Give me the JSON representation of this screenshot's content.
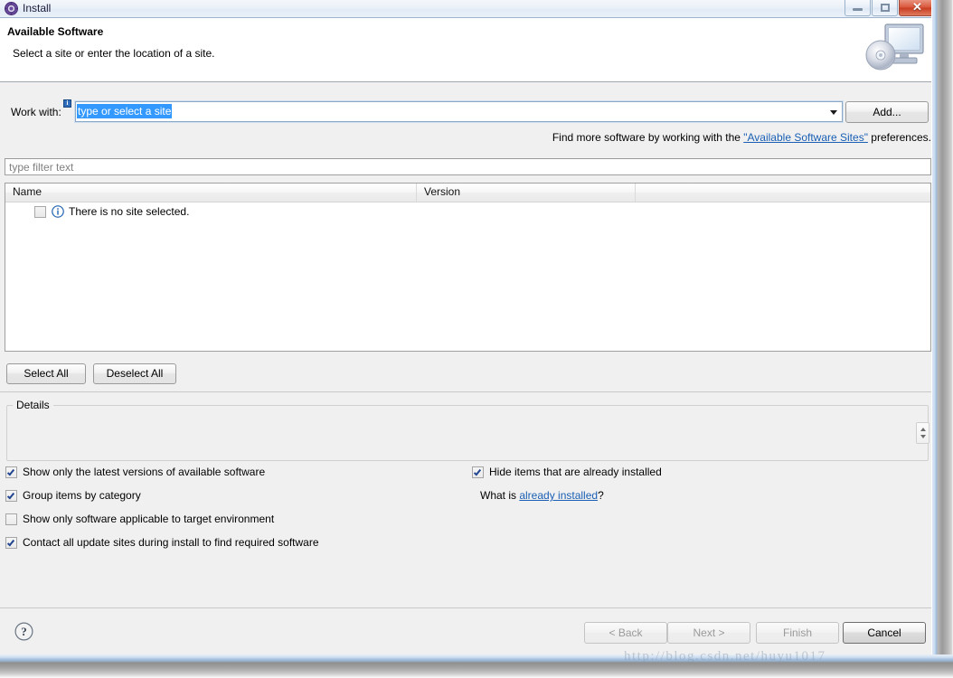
{
  "window": {
    "title": "Install",
    "icon": "install-gear-icon",
    "minimize_label": "Minimize",
    "maximize_label": "Restore",
    "close_label": "✕"
  },
  "header": {
    "title": "Available Software",
    "description": "Select a site or enter the location of a site.",
    "icon": "computer-disc-icon"
  },
  "work_with": {
    "label": "Work with:",
    "badge": "i",
    "value": "type or select a site",
    "placeholder": "type or select a site",
    "add_button": "Add..."
  },
  "find_more": {
    "prefix": "Find more software by working with the ",
    "link": "\"Available Software Sites\"",
    "suffix": " preferences."
  },
  "filter": {
    "placeholder": "type filter text",
    "value": "type filter text"
  },
  "table": {
    "columns": [
      "Name",
      "Version",
      ""
    ],
    "rows": [
      {
        "checked": false,
        "icon": "info-icon",
        "name": "There is no site selected.",
        "version": ""
      }
    ]
  },
  "selection_buttons": {
    "select_all": "Select All",
    "deselect_all": "Deselect All"
  },
  "details": {
    "legend": "Details",
    "content": "",
    "scroll_up_icon": "caret-up-icon",
    "scroll_down_icon": "caret-down-icon"
  },
  "options": {
    "left": [
      {
        "label": "Show only the latest versions of available software",
        "checked": true
      },
      {
        "label": "Group items by category",
        "checked": true
      },
      {
        "label": "Show only software applicable to target environment",
        "checked": false
      },
      {
        "label": "Contact all update sites during install to find required software",
        "checked": true
      }
    ],
    "right": [
      {
        "label": "Hide items that are already installed",
        "checked": true
      }
    ],
    "what_is": {
      "prefix": "What is ",
      "link": "already installed",
      "suffix": "?"
    }
  },
  "footer": {
    "help_icon": "help-question-icon",
    "back": "< Back",
    "next": "Next >",
    "finish": "Finish",
    "cancel": "Cancel"
  },
  "watermark": "http://blog.csdn.net/huyu1017",
  "colors": {
    "accent": "#3399ff",
    "link": "#1a5fb4",
    "close_button": "#c83c22",
    "dialog_bg": "#f0f0f0"
  }
}
